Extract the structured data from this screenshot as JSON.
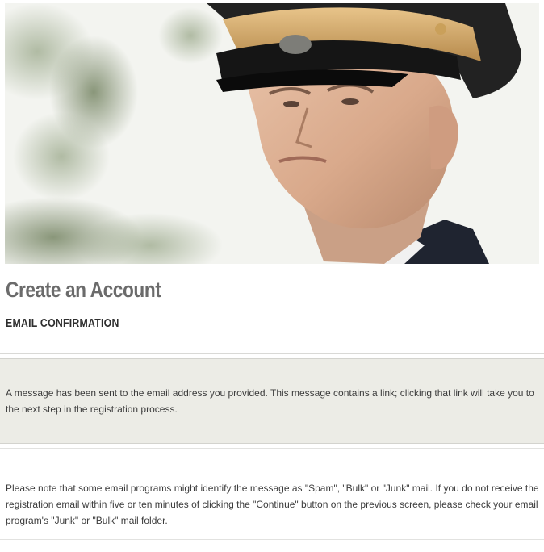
{
  "hero": {
    "image": "officer-portrait"
  },
  "page": {
    "title": "Create an Account",
    "section": "EMAIL CONFIRMATION"
  },
  "notice": {
    "text": "A message has been sent to the email address you provided. This message contains a link; clicking that link will take you to the next step in the registration process."
  },
  "note": {
    "text": "Please note that some email programs might identify the message as \"Spam\", \"Bulk\" or \"Junk\" mail. If you do not receive the registration email within five or ten minutes of clicking the \"Continue\" button on the previous screen, please check your email program's \"Junk\" or \"Bulk\" mail folder."
  },
  "colors": {
    "title": "#6b6b6b",
    "notice_bg": "#ecece6",
    "cap_gold": "#d9b070",
    "cap_dark": "#1c1c1c"
  }
}
